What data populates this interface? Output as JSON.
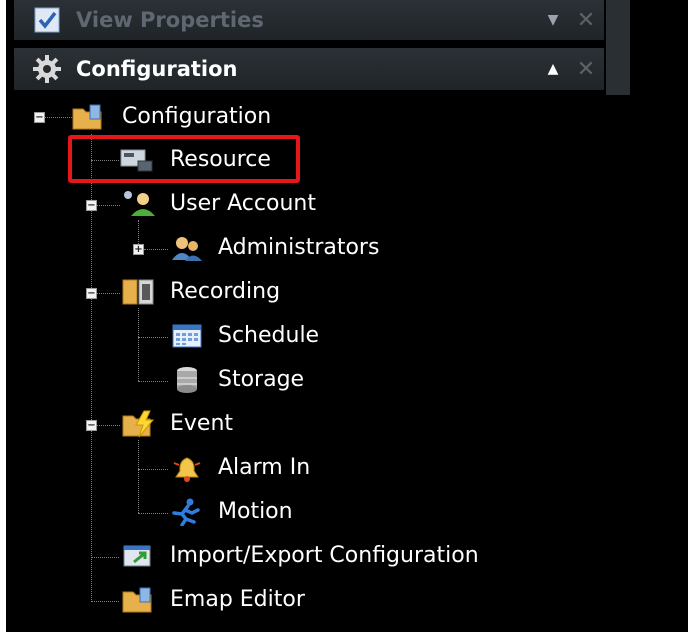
{
  "panels": {
    "view_properties": {
      "title": "View Properties",
      "arrow": "▼",
      "close": "✕"
    },
    "configuration": {
      "title": "Configuration",
      "arrow": "▲",
      "close": "✕"
    }
  },
  "tree": {
    "root": "Configuration",
    "resource": "Resource",
    "user_account": "User Account",
    "administrators": "Administrators",
    "recording": "Recording",
    "schedule": "Schedule",
    "storage": "Storage",
    "event": "Event",
    "alarm_in": "Alarm In",
    "motion": "Motion",
    "import_export": "Import/Export Configuration",
    "emap_editor": "Emap Editor"
  },
  "selected_item": "Resource",
  "colors": {
    "highlight": "#e41818",
    "background": "#000000",
    "header": "#262b30"
  }
}
